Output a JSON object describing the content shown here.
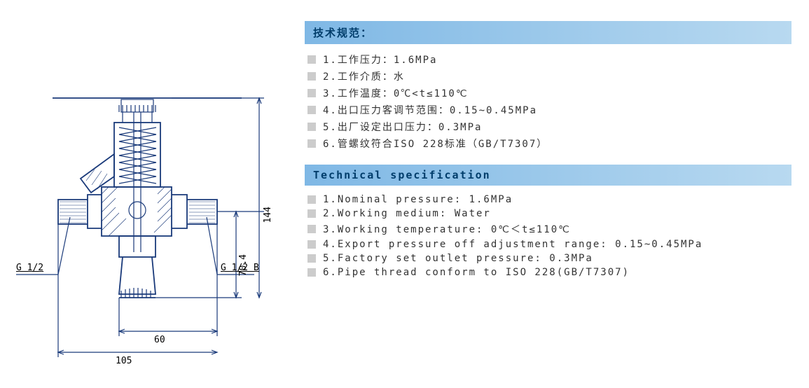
{
  "diagram": {
    "thread_left": "G 1/2",
    "thread_right": "G 1/2 B",
    "dim_height_overall": "144",
    "dim_height_lower": "70.4",
    "dim_width_inner": "60",
    "dim_width_overall": "105"
  },
  "spec_cn": {
    "header": "技术规范：",
    "items": [
      "1.工作压力：1.6MPa",
      "2.工作介质：水",
      "3.工作温度：0℃<t≤110℃",
      "4.出口压力客调节范围：0.15~0.45MPa",
      "5.出厂设定出口压力：0.3MPa",
      "6.管螺纹符合ISO 228标准（GB/T7307）"
    ]
  },
  "spec_en": {
    "header": "Technical specification",
    "items": [
      "1.Nominal pressure: 1.6MPa",
      "2.Working medium: Water",
      "3.Working temperature: 0℃＜t≤110℃",
      "4.Export pressure off adjustment range: 0.15~0.45MPa",
      "5.Factory set outlet pressure: 0.3MPa",
      "6.Pipe thread conform to ISO 228(GB/T7307)"
    ]
  }
}
